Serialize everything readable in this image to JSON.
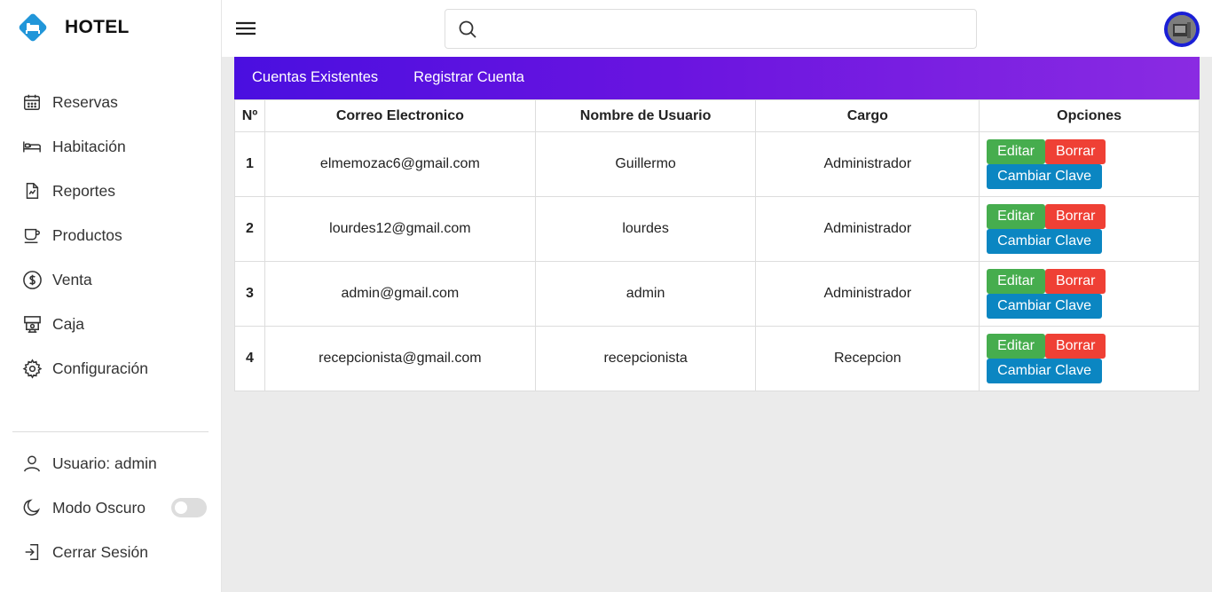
{
  "brand": {
    "title": "HOTEL"
  },
  "nav": [
    {
      "label": "Reservas",
      "icon": "calendar-icon"
    },
    {
      "label": "Habitación",
      "icon": "bed-icon"
    },
    {
      "label": "Reportes",
      "icon": "report-icon"
    },
    {
      "label": "Productos",
      "icon": "cup-icon"
    },
    {
      "label": "Venta",
      "icon": "dollar-icon"
    },
    {
      "label": "Caja",
      "icon": "cash-register-icon"
    },
    {
      "label": "Configuración",
      "icon": "gear-icon"
    }
  ],
  "bottom": {
    "user_label": "Usuario: admin",
    "dark_mode_label": "Modo Oscuro",
    "dark_mode_on": false,
    "logout_label": "Cerrar Sesión"
  },
  "search": {
    "placeholder": "",
    "value": ""
  },
  "tabs": [
    "Cuentas Existentes",
    "Registrar Cuenta"
  ],
  "table": {
    "headers": [
      "Nº",
      "Correo Electronico",
      "Nombre de Usuario",
      "Cargo",
      "Opciones"
    ],
    "rows": [
      {
        "n": "1",
        "email": "elmemozac6@gmail.com",
        "user": "Guillermo",
        "role": "Administrador"
      },
      {
        "n": "2",
        "email": "lourdes12@gmail.com",
        "user": "lourdes",
        "role": "Administrador"
      },
      {
        "n": "3",
        "email": "admin@gmail.com",
        "user": "admin",
        "role": "Administrador"
      },
      {
        "n": "4",
        "email": "recepcionista@gmail.com",
        "user": "recepcionista",
        "role": "Recepcion"
      }
    ],
    "buttons": {
      "edit": "Editar",
      "delete": "Borrar",
      "change_password": "Cambiar Clave"
    }
  },
  "colors": {
    "accent_start": "#4a0fe0",
    "accent_end": "#8a2be2",
    "edit": "#46ad4e",
    "delete": "#ef4035",
    "change_password": "#0b86c2",
    "logo": "#2196d9"
  }
}
